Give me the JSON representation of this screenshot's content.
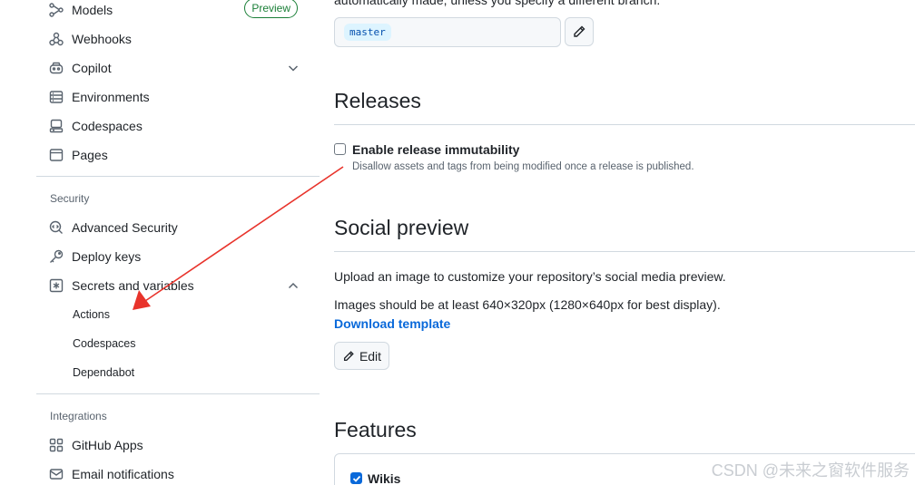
{
  "sidebar": {
    "items_top": [
      {
        "label": "Models",
        "icon": "models-icon",
        "badge": "Preview"
      },
      {
        "label": "Webhooks",
        "icon": "webhook-icon"
      },
      {
        "label": "Copilot",
        "icon": "copilot-icon",
        "chevron": "chevron-down-icon"
      },
      {
        "label": "Environments",
        "icon": "server-icon"
      },
      {
        "label": "Codespaces",
        "icon": "codespaces-icon"
      },
      {
        "label": "Pages",
        "icon": "browser-icon"
      }
    ],
    "security_heading": "Security",
    "security_items": [
      {
        "label": "Advanced Security",
        "icon": "codescan-icon"
      },
      {
        "label": "Deploy keys",
        "icon": "key-icon"
      },
      {
        "label": "Secrets and variables",
        "icon": "asterisk-icon",
        "chevron": "chevron-up-icon"
      }
    ],
    "secrets_subitems": [
      "Actions",
      "Codespaces",
      "Dependabot"
    ],
    "integrations_heading": "Integrations",
    "integrations_items": [
      {
        "label": "GitHub Apps",
        "icon": "apps-icon"
      },
      {
        "label": "Email notifications",
        "icon": "mail-icon"
      }
    ]
  },
  "main": {
    "cut_text": "automatically made, unless you specify a different branch.",
    "branch_value": "master",
    "releases": {
      "heading": "Releases",
      "checkbox_label": "Enable release immutability",
      "checked": false,
      "description": "Disallow assets and tags from being modified once a release is published."
    },
    "social_preview": {
      "heading": "Social preview",
      "text1": "Upload an image to customize your repository’s social media preview.",
      "text2": "Images should be at least 640×320px (1280×640px for best display).",
      "download_link": "Download template",
      "edit_button": "Edit"
    },
    "features": {
      "heading": "Features",
      "wikis_label": "Wikis",
      "wikis_checked": true
    }
  },
  "annotation": {
    "color": "#e8332b"
  },
  "watermark": "CSDN @未来之窗软件服务"
}
